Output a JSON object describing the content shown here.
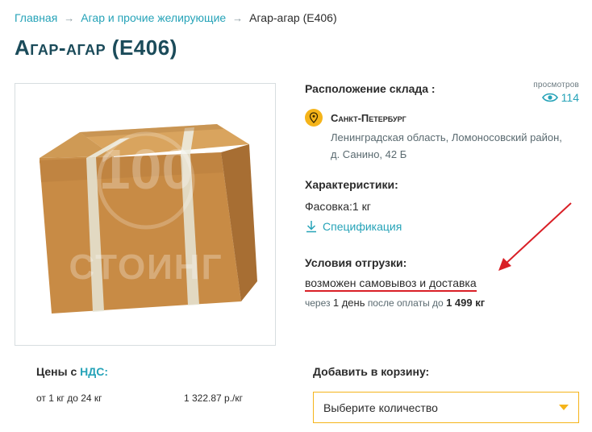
{
  "breadcrumb": {
    "items": [
      "Главная",
      "Агар и прочие желирующие",
      "Агар-агар (Е406)"
    ]
  },
  "page": {
    "title": "Агар-агар (Е406)"
  },
  "product_image": {
    "watermark": "100 СТОИНГ"
  },
  "views": {
    "label": "просмотров",
    "count": "114"
  },
  "warehouse": {
    "label": "Расположение склада :",
    "city": "Санкт-Петербург",
    "address": "Ленинградская область, Ломоносовский район, д. Санино, 42 Б"
  },
  "characteristics": {
    "label": "Характеристики:",
    "packing": "Фасовка:1 кг",
    "spec_link": "Спецификация"
  },
  "shipping": {
    "label": "Условия отгрузки:",
    "text": "возможен самовывоз и доставка",
    "line_prefix": "через",
    "line_days": "1 день",
    "line_middle": "после оплаты до",
    "line_amount": "1 499 кг"
  },
  "prices": {
    "label_prefix": "Цены с",
    "label_vat": "НДС:",
    "range": "от 1 кг до 24 кг",
    "value": "1 322.87 р./кг"
  },
  "cart": {
    "label": "Добавить в корзину:",
    "select_value": "Выберите количество"
  },
  "colors": {
    "accent": "#26a3b8",
    "title": "#1b4b5a",
    "highlight": "#f5b41a",
    "annotation": "#d91f26"
  }
}
